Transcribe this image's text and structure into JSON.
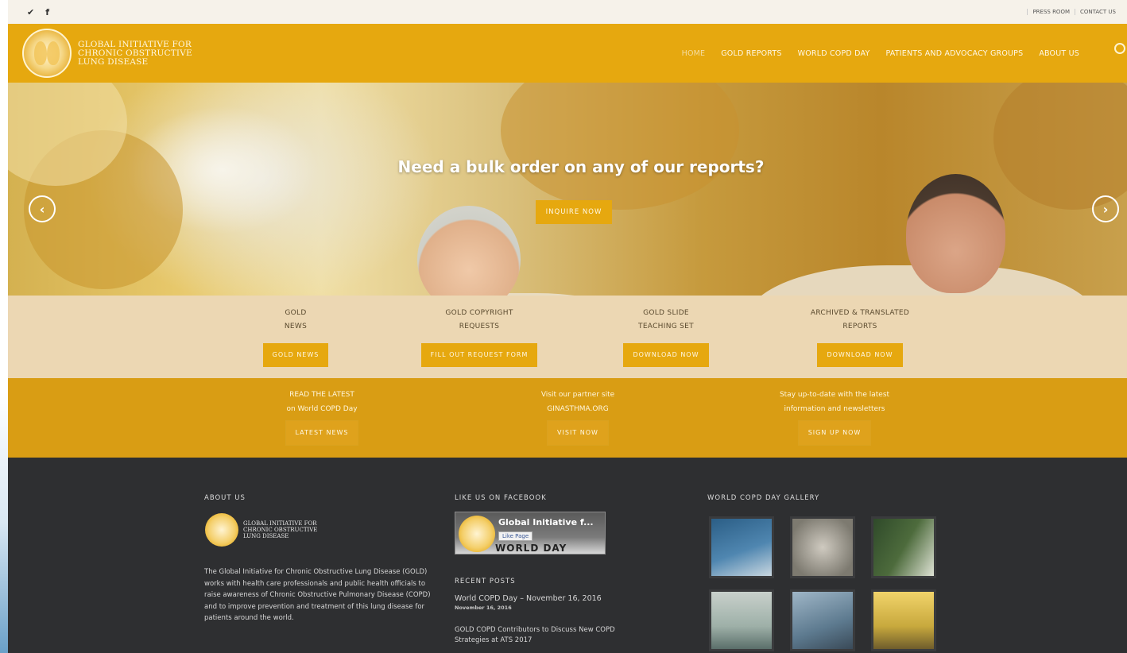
{
  "topbar": {
    "social": [
      "twitter-icon",
      "facebook-icon"
    ],
    "twitter_glyph": "✔",
    "facebook_glyph": "f",
    "links": [
      "PRESS ROOM",
      "CONTACT US"
    ]
  },
  "header": {
    "logo_text": [
      "GLOBAL INITIATIVE FOR",
      "CHRONIC OBSTRUCTIVE",
      "LUNG DISEASE"
    ],
    "nav": [
      "HOME",
      "GOLD REPORTS",
      "WORLD COPD DAY",
      "PATIENTS AND ADVOCACY GROUPS",
      "ABOUT US"
    ],
    "accent": "#e6a80f"
  },
  "hero": {
    "title": "Need a bulk order on any of our reports?",
    "button": "INQUIRE NOW",
    "prev": "‹",
    "next": "›"
  },
  "band1": [
    {
      "l1": "GOLD",
      "l2": "NEWS",
      "btn": "GOLD NEWS"
    },
    {
      "l1": "GOLD COPYRIGHT",
      "l2": "REQUESTS",
      "btn": "FILL OUT REQUEST FORM"
    },
    {
      "l1": "GOLD SLIDE",
      "l2": "TEACHING SET",
      "btn": "DOWNLOAD NOW"
    },
    {
      "l1": "ARCHIVED & TRANSLATED",
      "l2": "REPORTS",
      "btn": "DOWNLOAD NOW"
    }
  ],
  "band2": [
    {
      "l1": "READ THE LATEST",
      "l2": "on World COPD Day",
      "btn": "LATEST NEWS"
    },
    {
      "l1": "Visit our partner site",
      "l2": "GINASTHMA.ORG",
      "btn": "VISIT NOW"
    },
    {
      "l1": "Stay up-to-date with the latest",
      "l2": "information and newsletters",
      "btn": "SIGN UP NOW"
    }
  ],
  "footer": {
    "about_heading": "ABOUT US",
    "about_logo": [
      "GLOBAL INITIATIVE FOR",
      "CHRONIC OBSTRUCTIVE",
      "LUNG DISEASE"
    ],
    "about_text": "The Global Initiative for Chronic Obstructive Lung Disease (GOLD) works with health care professionals and public health officials to raise awareness of Chronic Obstructive Pulmonary Disease (COPD) and to improve prevention and treatment of this lung disease for patients around the world.",
    "facebook_heading": "LIKE US ON FACEBOOK",
    "fb_name": "Global Initiative f...",
    "fb_like": "Like Page",
    "fb_banner": "WORLD DAY",
    "recent_heading": "RECENT POSTS",
    "posts": [
      {
        "title": "World COPD Day – November 16, 2016",
        "date": "November 16, 2016"
      },
      {
        "title": "GOLD COPD Contributors to Discuss New COPD",
        "title2": "Strategies at ATS 2017"
      }
    ],
    "gallery_heading": "WORLD COPD DAY GALLERY",
    "gallery_colors": [
      "#2b5e86",
      "#7d7a70",
      "#4d6b3c",
      "#9eb0a8",
      "#5d7a8f",
      "#c8a93d"
    ]
  }
}
